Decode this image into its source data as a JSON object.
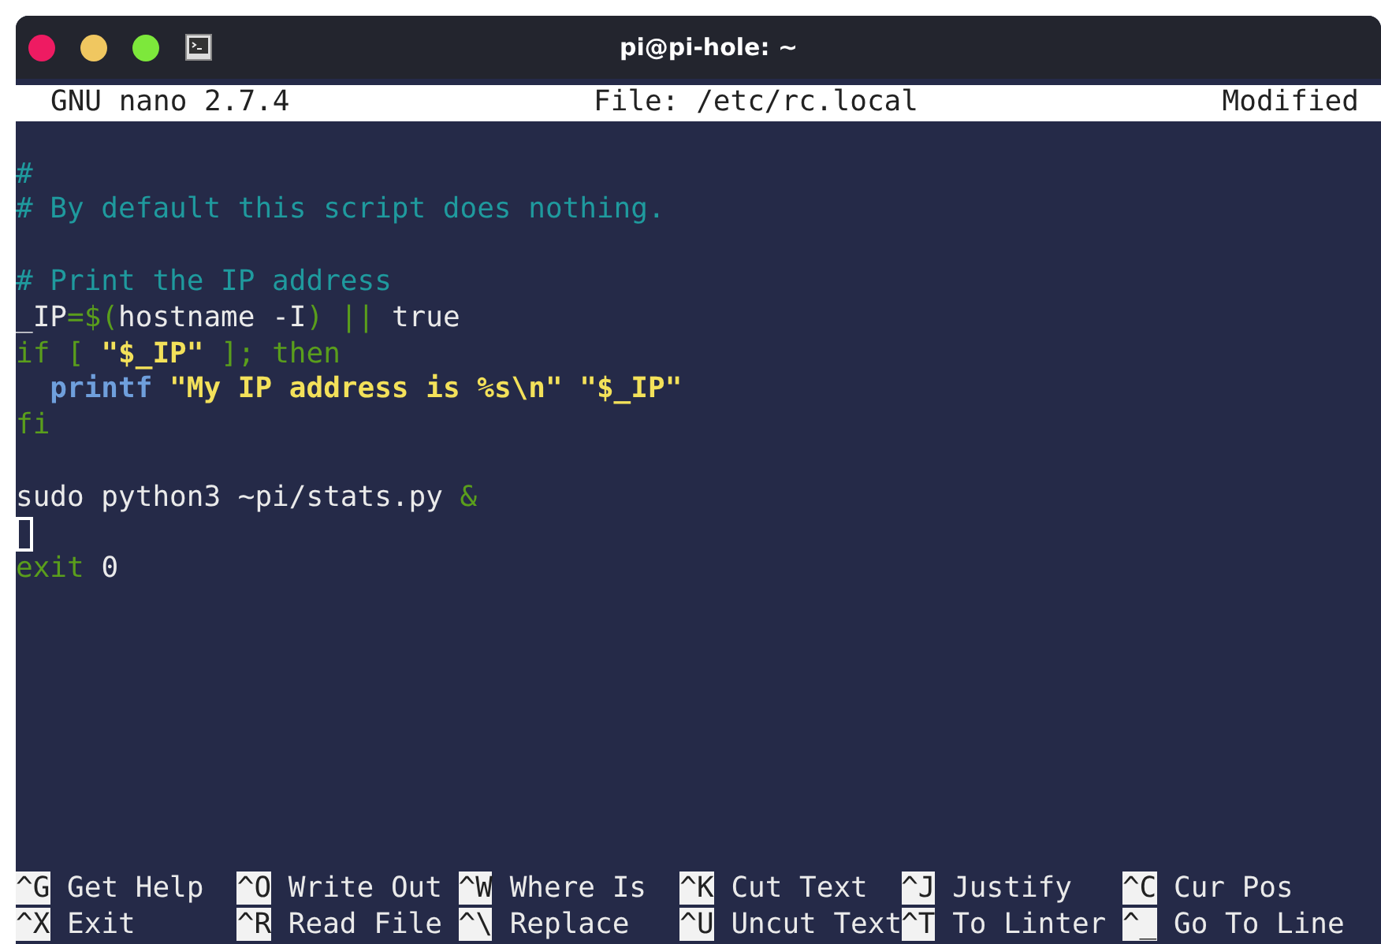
{
  "window": {
    "title": "pi@pi-hole: ~"
  },
  "header": {
    "app": "GNU nano 2.7.4",
    "file": "File: /etc/rc.local",
    "status": "Modified"
  },
  "lines": [
    {
      "kind": "blank"
    },
    {
      "kind": "code",
      "segments": [
        {
          "text": "#",
          "kind": "comment"
        }
      ]
    },
    {
      "kind": "code",
      "segments": [
        {
          "text": "# By default this script does nothing.",
          "kind": "comment"
        }
      ]
    },
    {
      "kind": "blank"
    },
    {
      "kind": "code",
      "segments": [
        {
          "text": "# Print the IP address",
          "kind": "comment"
        }
      ]
    },
    {
      "kind": "code",
      "segments": [
        {
          "text": "_IP",
          "kind": "plain"
        },
        {
          "text": "=$(",
          "kind": "keyword"
        },
        {
          "text": "hostname -I",
          "kind": "plain"
        },
        {
          "text": ") || ",
          "kind": "keyword"
        },
        {
          "text": "true",
          "kind": "plain"
        }
      ]
    },
    {
      "kind": "code",
      "segments": [
        {
          "text": "if [ ",
          "kind": "keyword"
        },
        {
          "text": "\"$_IP\"",
          "kind": "string"
        },
        {
          "text": " ]; then",
          "kind": "keyword"
        }
      ]
    },
    {
      "kind": "code",
      "segments": [
        {
          "text": "  printf ",
          "kind": "builtin"
        },
        {
          "text": "\"My IP address is %s\\n\" \"$_IP\"",
          "kind": "string"
        }
      ]
    },
    {
      "kind": "code",
      "segments": [
        {
          "text": "fi",
          "kind": "keyword"
        }
      ]
    },
    {
      "kind": "blank"
    },
    {
      "kind": "code",
      "segments": [
        {
          "text": "sudo python3 ~pi/stats.py ",
          "kind": "plain"
        },
        {
          "text": "&",
          "kind": "keyword"
        }
      ]
    },
    {
      "kind": "cursor"
    },
    {
      "kind": "code",
      "segments": [
        {
          "text": "exit",
          "kind": "keyword"
        },
        {
          "text": " 0",
          "kind": "plain"
        }
      ]
    }
  ],
  "shortcuts": [
    {
      "key": "^G",
      "label": "Get Help"
    },
    {
      "key": "^O",
      "label": "Write Out"
    },
    {
      "key": "^W",
      "label": "Where Is"
    },
    {
      "key": "^K",
      "label": "Cut Text"
    },
    {
      "key": "^J",
      "label": "Justify"
    },
    {
      "key": "^C",
      "label": "Cur Pos"
    },
    {
      "key": "^X",
      "label": "Exit"
    },
    {
      "key": "^R",
      "label": "Read File"
    },
    {
      "key": "^\\",
      "label": "Replace"
    },
    {
      "key": "^U",
      "label": "Uncut Text"
    },
    {
      "key": "^T",
      "label": "To Linter"
    },
    {
      "key": "^_",
      "label": "Go To Line"
    }
  ]
}
